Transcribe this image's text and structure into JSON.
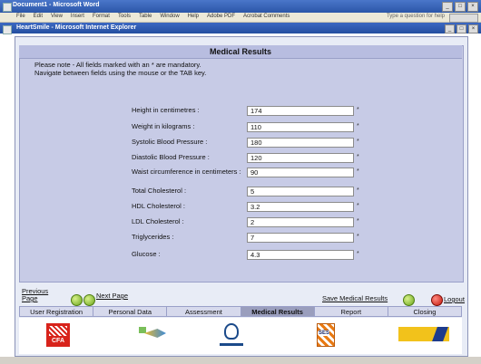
{
  "window": {
    "title": "Document1 - Microsoft Word",
    "menu": [
      "File",
      "Edit",
      "View",
      "Insert",
      "Format",
      "Tools",
      "Table",
      "Window",
      "Help",
      "Adobe PDF",
      "Acrobat Comments"
    ],
    "menu_right": "Type a question for help"
  },
  "browser": {
    "title": "HeartSmile - Microsoft Internet Explorer"
  },
  "page": {
    "title": "Medical Results",
    "note_line1": "Please note - All fields marked with an * are mandatory.",
    "note_line2": "Navigate between fields using the mouse or the TAB key."
  },
  "form": {
    "fields": [
      {
        "label": "Height in centimetres :",
        "value": "174",
        "required": "*"
      },
      {
        "label": "Weight in kilograms :",
        "value": "110",
        "required": "*"
      },
      {
        "label": "Systolic Blood Pressure :",
        "value": "180",
        "required": "*"
      },
      {
        "label": "Diastolic Blood Pressure :",
        "value": "120",
        "required": "*"
      },
      {
        "label": "Waist circumference in centimeters :",
        "value": "90",
        "required": "*"
      },
      {
        "label": "Total Cholesterol :",
        "value": "5",
        "required": "*"
      },
      {
        "label": "HDL Cholesterol :",
        "value": "3.2",
        "required": "*"
      },
      {
        "label": "LDL Cholesterol :",
        "value": "2",
        "required": "*"
      },
      {
        "label": "Triglycerides :",
        "value": "7",
        "required": "*"
      },
      {
        "label": "Glucose :",
        "value": "4.3",
        "required": "*"
      }
    ]
  },
  "nav": {
    "previous_line1": "Previous",
    "previous_line2": "Page",
    "next": "Next Page",
    "save": "Save Medical Results",
    "logout": "Logout"
  },
  "tabs": [
    {
      "label": "User Registration",
      "active": false
    },
    {
      "label": "Personal Data",
      "active": false
    },
    {
      "label": "Assessment",
      "active": false
    },
    {
      "label": "Medical Results",
      "active": true
    },
    {
      "label": "Report",
      "active": false
    },
    {
      "label": "Closing",
      "active": false
    }
  ],
  "logos": {
    "cfa": "CFA",
    "ses": "SES"
  },
  "colors": {
    "panel_bg": "#c7cbe6",
    "active_tab": "#9a9ebd",
    "title_bar": "#3c68c2"
  }
}
